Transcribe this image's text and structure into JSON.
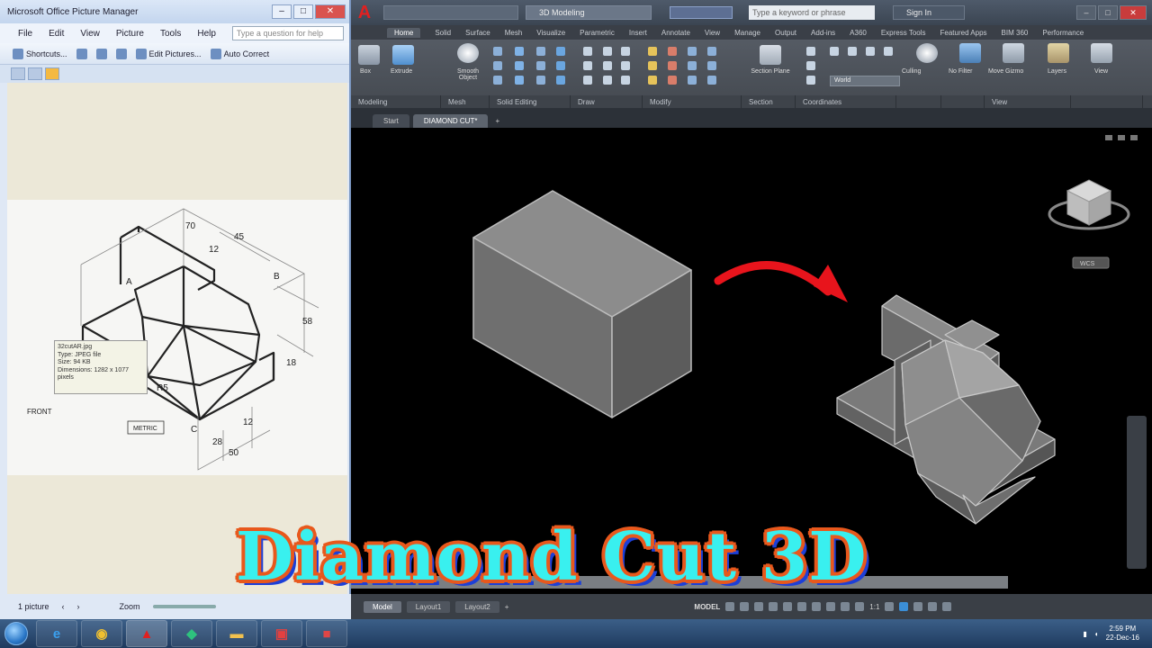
{
  "picture_manager": {
    "title": "Microsoft Office Picture Manager",
    "menu": [
      "File",
      "Edit",
      "View",
      "Picture",
      "Tools",
      "Help"
    ],
    "help_placeholder": "Type a question for help",
    "toolbar": [
      "Shortcuts...",
      "Edit Pictures...",
      "Auto Correct"
    ],
    "drawing_labels": {
      "dim_70": "70",
      "dim_45": "45",
      "dim_12a": "12",
      "dim_58": "58",
      "dim_18": "18",
      "dim_28": "28",
      "dim_12b": "12",
      "dim_50": "50",
      "dim_r": "R5",
      "point_a": "A",
      "point_b": "B",
      "point_c": "C",
      "metric": "METRIC",
      "front": "FRONT"
    },
    "tooltip": {
      "name": "32cutAR.jpg",
      "type": "Type: JPEG file",
      "size": "Size: 94 KB",
      "dimensions": "Dimensions: 1282 x 1077",
      "unit": "pixels"
    },
    "status": {
      "left": "1 picture",
      "zoom_label": "Zoom"
    }
  },
  "autocad": {
    "workspace": "3D Modeling",
    "search_placeholder": "Type a keyword or phrase",
    "sign_in": "Sign In",
    "ribbon_tabs": [
      "Home",
      "Solid",
      "Surface",
      "Mesh",
      "Visualize",
      "Parametric",
      "Insert",
      "Annotate",
      "View",
      "Manage",
      "Output",
      "Add-ins",
      "A360",
      "Express Tools",
      "Featured Apps",
      "BIM 360",
      "Performance"
    ],
    "ribbon_groups": [
      "Modeling",
      "Mesh",
      "Solid Editing",
      "Draw",
      "Modify",
      "Section",
      "Coordinates",
      "",
      "",
      "View",
      ""
    ],
    "ribbon_buttons": [
      "Box",
      "Extrude",
      "Smooth Object",
      "Section Plane",
      "Culling",
      "No Filter",
      "Move Gizmo",
      "Layers",
      "View"
    ],
    "view_dropdown": "World",
    "doc_tabs": [
      "Start",
      "DIAMOND CUT*",
      "+"
    ],
    "layout_tabs": [
      "Model",
      "Layout1",
      "Layout2",
      "+"
    ],
    "model_label": "MODEL",
    "scale_label": "1:1",
    "viewcube_label": "WCS",
    "arrow_color": "#e8141c"
  },
  "taskbar": {
    "apps": [
      "internet-explorer",
      "chrome",
      "autocad",
      "app-green",
      "file-explorer",
      "media",
      "camtasia"
    ],
    "time": "2:59 PM",
    "date": "22-Dec-16"
  },
  "overlay": {
    "title": "Diamond Cut 3D",
    "fill_color": "#39f0ef",
    "outline_color": "#e8581c",
    "shadow_color": "#1c3fd8"
  }
}
